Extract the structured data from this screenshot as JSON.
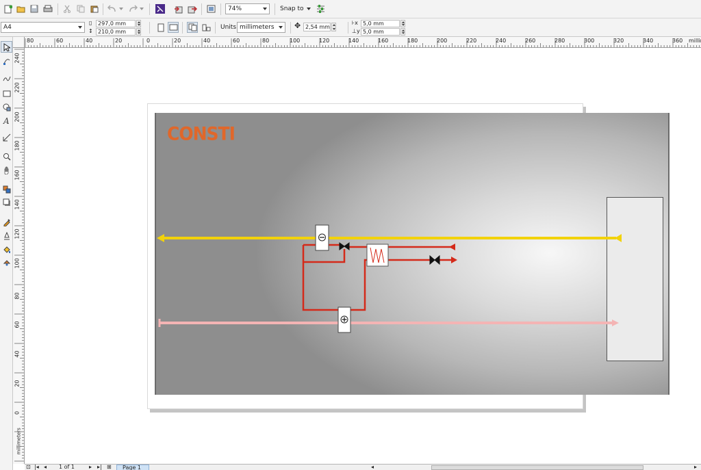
{
  "toolbar": {
    "zoom_value": "74%",
    "snap_label": "Snap to"
  },
  "property_bar": {
    "page_size": "A4",
    "width": "297,0 mm",
    "height": "210,0 mm",
    "units_label": "Units:",
    "units_value": "millimeters",
    "nudge": "2,54 mm",
    "dup_x": "5,0 mm",
    "dup_y": "5,0 mm"
  },
  "ruler": {
    "h_labels": [
      "80",
      "60",
      "40",
      "20",
      "0",
      "20",
      "40",
      "60",
      "80",
      "100",
      "120",
      "140",
      "160",
      "180",
      "200",
      "220",
      "240",
      "260",
      "280",
      "300",
      "320",
      "340",
      "360",
      "millim"
    ],
    "v_labels": [
      "240",
      "220",
      "200",
      "180",
      "160",
      "140",
      "120",
      "100",
      "80",
      "60",
      "40",
      "20",
      "0"
    ],
    "v_unit": "millimeters"
  },
  "drawing": {
    "logo_text": "CONSTI",
    "colors": {
      "yellow_line": "#f2d20b",
      "pink_line": "#f4b4b4",
      "red_pipe": "#d42a1a",
      "logo": "#e0672a"
    }
  },
  "status": {
    "page_count": "1 of 1",
    "page_tab": "Page 1"
  }
}
